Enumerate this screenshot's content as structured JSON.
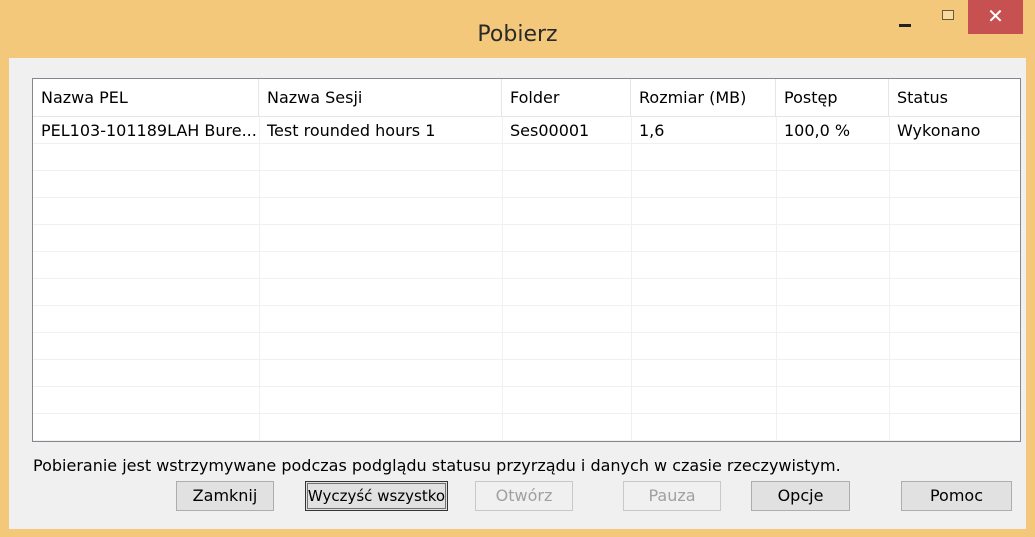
{
  "window": {
    "title": "Pobierz",
    "close_glyph": "✕"
  },
  "table": {
    "columns": [
      "Nazwa PEL",
      "Nazwa Sesji",
      "Folder",
      "Rozmiar (MB)",
      "Postęp",
      "Status"
    ],
    "rows": [
      [
        "PEL103-101189LAH Bure...",
        "Test rounded hours 1",
        "Ses00001",
        "1,6",
        "100,0 %",
        "Wykonano"
      ]
    ]
  },
  "info_text": "Pobieranie jest wstrzymywane podczas podglądu statusu przyrządu i danych w czasie rzeczywistym.",
  "buttons": {
    "close": "Zamknij",
    "clear_all": "Wyczyść wszystko",
    "open": "Otwórz",
    "pause": "Pauza",
    "options": "Opcje",
    "help": "Pomoc"
  },
  "colors": {
    "titlebar": "#f4c87a",
    "close_button": "#c75050",
    "client_bg": "#f0f0f0"
  }
}
